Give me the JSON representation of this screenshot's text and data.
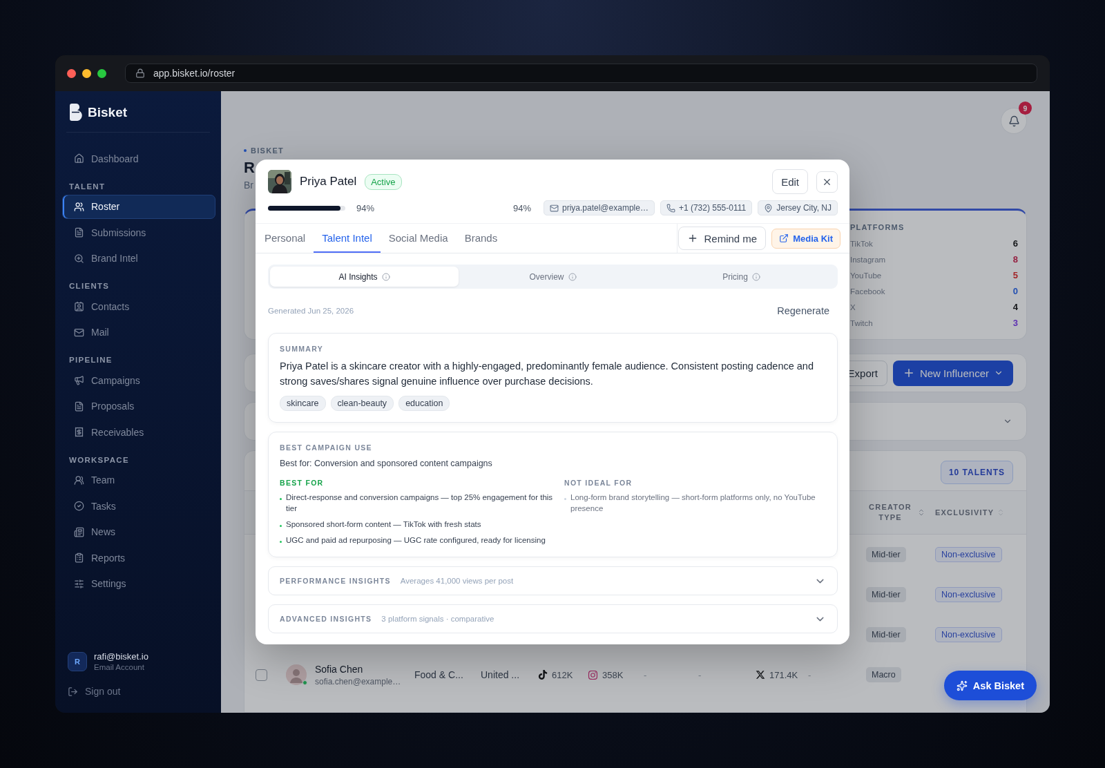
{
  "browser": {
    "url": "app.bisket.io/roster"
  },
  "sidebar": {
    "brand": "Bisket",
    "sections": [
      {
        "items": [
          {
            "label": "Dashboard",
            "selected": false
          }
        ]
      },
      {
        "title": "TALENT",
        "items": [
          {
            "label": "Roster",
            "selected": true
          },
          {
            "label": "Submissions",
            "selected": false
          },
          {
            "label": "Brand Intel",
            "selected": false
          }
        ]
      },
      {
        "title": "CLIENTS",
        "items": [
          {
            "label": "Contacts",
            "selected": false
          },
          {
            "label": "Mail",
            "selected": false
          }
        ]
      },
      {
        "title": "PIPELINE",
        "items": [
          {
            "label": "Campaigns",
            "selected": false
          },
          {
            "label": "Proposals",
            "selected": false
          },
          {
            "label": "Receivables",
            "selected": false
          }
        ]
      },
      {
        "title": "WORKSPACE",
        "items": [
          {
            "label": "Team",
            "selected": false
          },
          {
            "label": "Tasks",
            "selected": false
          },
          {
            "label": "News",
            "selected": false
          },
          {
            "label": "Reports",
            "selected": false
          },
          {
            "label": "Settings",
            "selected": false
          }
        ]
      }
    ],
    "account": {
      "initial": "R",
      "email": "rafi@bisket.io",
      "type": "Email Account"
    },
    "sign_out": "Sign out"
  },
  "header": {
    "notifications": "9",
    "breadcrumb": "BISKET",
    "title": "R",
    "subtitle": "Br"
  },
  "platforms": {
    "title": "PLATFORMS",
    "items": [
      {
        "name": "TikTok",
        "count": "6",
        "color": "#141619"
      },
      {
        "name": "Instagram",
        "count": "8",
        "color": "#941f40"
      },
      {
        "name": "YouTube",
        "count": "5",
        "color": "#a22427"
      },
      {
        "name": "Facebook",
        "count": "0",
        "color": "#224fb1"
      },
      {
        "name": "X",
        "count": "4",
        "color": "#141619"
      },
      {
        "name": "Twitch",
        "count": "3",
        "color": "#5f32b2"
      }
    ]
  },
  "actions": {
    "export": "Export",
    "new_influencer": "New Influencer"
  },
  "table": {
    "count": "10 TALENTS",
    "columns": [
      {
        "label": "CREATOR TYPE"
      },
      {
        "label": "EXCLUSIVITY"
      }
    ],
    "rows": [
      {
        "creator_type": "Mid-tier",
        "exclusivity": "Non-exclusive"
      },
      {
        "creator_type": "Mid-tier",
        "exclusivity": "Non-exclusive"
      },
      {
        "creator_type": "Mid-tier",
        "exclusivity": "Non-exclusive"
      },
      {
        "checked": false,
        "name": "Sofia Chen",
        "email": "sofia.chen@example…",
        "online": true,
        "niche": "Food & C...",
        "location": "United ...",
        "tiktok": "612K",
        "instagram": "358K",
        "youtube": "-",
        "facebook": "-",
        "x": "171.4K",
        "twitch": "-",
        "creator_type": "Macro"
      }
    ]
  },
  "ask_button": "Ask Bisket",
  "modal": {
    "name": "Priya Patel",
    "status": "Active",
    "edit": "Edit",
    "completion": {
      "level": 0.94,
      "reading": "94%"
    },
    "score": "94%",
    "contacts": [
      {
        "kind": "email",
        "text": "priya.patel@example…"
      },
      {
        "kind": "phone",
        "text": "+1 (732) 555-0111"
      },
      {
        "kind": "location",
        "text": "Jersey City, NJ"
      }
    ],
    "tabs": [
      {
        "label": "Personal",
        "selected": false
      },
      {
        "label": "Talent Intel",
        "selected": true
      },
      {
        "label": "Social Media",
        "selected": false
      },
      {
        "label": "Brands",
        "selected": false
      }
    ],
    "remind": "Remind me",
    "media_kit": "Media Kit",
    "segments": [
      {
        "label": "AI Insights",
        "selected": true
      },
      {
        "label": "Overview",
        "selected": false
      },
      {
        "label": "Pricing",
        "selected": false
      }
    ],
    "generated": "Generated Jun 25, 2026",
    "regenerate": "Regenerate",
    "summary": {
      "title": "SUMMARY",
      "text": "Priya Patel is a skincare creator with a highly-engaged, predominantly female audience. Consistent posting cadence and strong saves/shares signal genuine influence over purchase decisions.",
      "tags": [
        "skincare",
        "clean-beauty",
        "education"
      ]
    },
    "campaign": {
      "title": "BEST CAMPAIGN USE",
      "lead": "Best for: Conversion and sponsored content campaigns",
      "best_for": {
        "title": "BEST FOR",
        "items": [
          "Direct-response and conversion campaigns — top 25% engagement for this tier",
          "Sponsored short-form content — TikTok with fresh stats",
          "UGC and paid ad repurposing — UGC rate configured, ready for licensing"
        ]
      },
      "not_ideal": {
        "title": "NOT IDEAL FOR",
        "items": [
          "Long-form brand storytelling — short-form platforms only, no YouTube presence"
        ]
      }
    },
    "sections": [
      {
        "title": "PERFORMANCE INSIGHTS",
        "note": "Averages 41,000 views per post",
        "expanded": false
      },
      {
        "title": "ADVANCED INSIGHTS",
        "note": "3 platform signals · comparative",
        "expanded": false
      }
    ]
  }
}
